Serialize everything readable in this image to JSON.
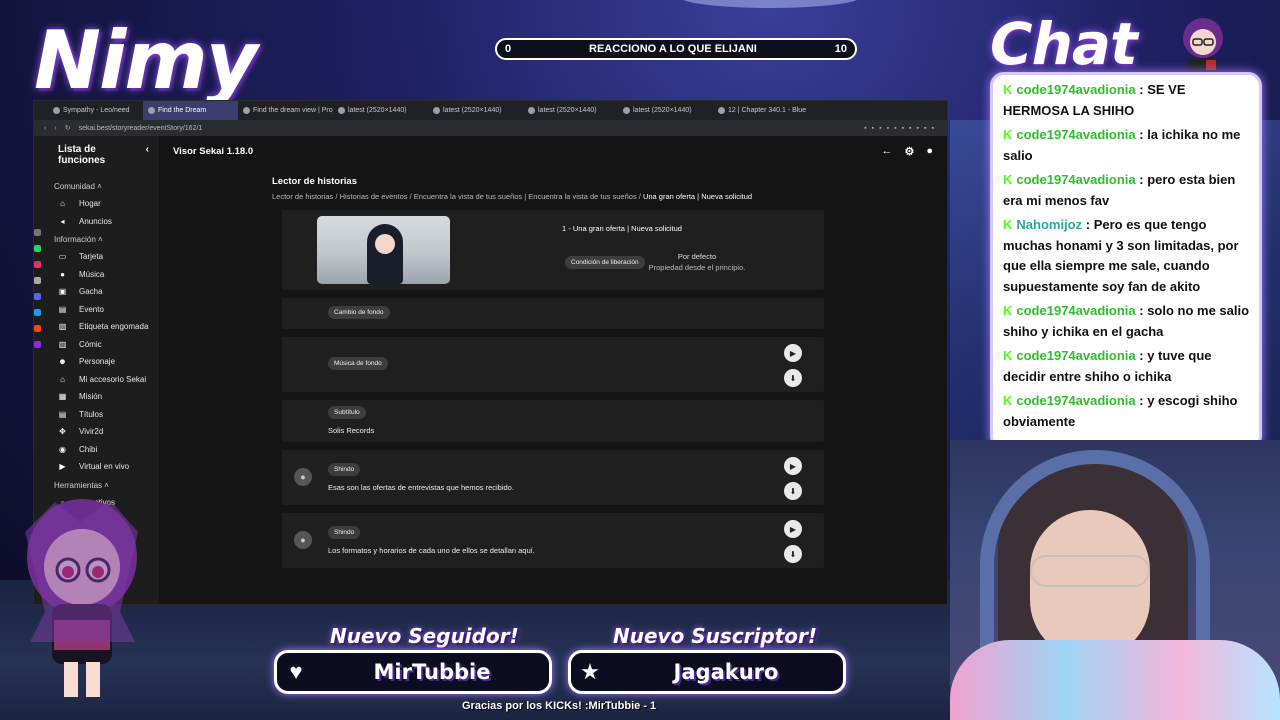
{
  "overlay": {
    "streamer_name": "Nimy",
    "chat_title": "Chat",
    "progress": {
      "left": "0",
      "label": "REACCIONO A LO QUE ELIJANI",
      "right": "10"
    },
    "follower_title": "Nuevo Seguidor!",
    "follower_name": "MirTubbie",
    "subscriber_title": "Nuevo Suscriptor!",
    "subscriber_name": "Jagakuro",
    "thanks": "Gracias por los KICKs! :MirTubbie - 1"
  },
  "browser": {
    "tabs": [
      "Sympathy - Leo/need",
      "Find the Dream",
      "Find the dream view | Proj",
      "latest (2520×1440)",
      "latest (2520×1440)",
      "latest (2520×1440)",
      "latest (2520×1440)",
      "12 | Chapter 340.1 - Blue L"
    ],
    "url": "sekai.best/storyreader/eventStory/162/1"
  },
  "sidebar": {
    "title": "Lista de funciones",
    "sections": [
      {
        "label": "Comunidad",
        "items": [
          {
            "label": "Hogar",
            "icon": "home-icon",
            "glyph": "⌂"
          },
          {
            "label": "Anuncios",
            "icon": "megaphone-icon",
            "glyph": "◂"
          }
        ]
      },
      {
        "label": "Información",
        "items": [
          {
            "label": "Tarjeta",
            "icon": "card-icon",
            "glyph": "▭"
          },
          {
            "label": "Música",
            "icon": "music-icon",
            "glyph": "●"
          },
          {
            "label": "Gacha",
            "icon": "gacha-icon",
            "glyph": "▣"
          },
          {
            "label": "Evento",
            "icon": "calendar-icon",
            "glyph": "▤"
          },
          {
            "label": "Etiqueta engomada",
            "icon": "sticker-icon",
            "glyph": "▧"
          },
          {
            "label": "Cómic",
            "icon": "comic-icon",
            "glyph": "▥"
          },
          {
            "label": "Personaje",
            "icon": "people-icon",
            "glyph": "☻"
          },
          {
            "label": "Mi accesorio Sekai",
            "icon": "home-icon",
            "glyph": "⌂"
          },
          {
            "label": "Misión",
            "icon": "mission-icon",
            "glyph": "▦"
          },
          {
            "label": "Títulos",
            "icon": "title-icon",
            "glyph": "▤"
          },
          {
            "label": "Vivir2d",
            "icon": "move-icon",
            "glyph": "✥"
          },
          {
            "label": "Chibi",
            "icon": "chibi-icon",
            "glyph": "◉"
          },
          {
            "label": "Virtual en vivo",
            "icon": "live-icon",
            "glyph": "▶"
          }
        ]
      },
      {
        "label": "Herramientas",
        "items": [
          {
            "label": "de activos",
            "icon": "asset-icon",
            "glyph": "▫"
          }
        ]
      }
    ]
  },
  "app": {
    "title": "Visor Sekai 1.18.0",
    "page_heading": "Lector de historias",
    "breadcrumbs": [
      "Lector de historias",
      "Historias de eventos",
      "Encuentra la vista de tus sueños | Encuentra la vista de tus sueños",
      "Una gran oferta | Nueva solicitud"
    ],
    "episode_title": "1 - Una gran oferta | Nueva solicitud",
    "release_chip": "Condición de liberación",
    "release_title": "Por defecto",
    "release_desc": "Propiedad desde el principio.",
    "blocks": [
      {
        "chip": "Cambio de fondo"
      },
      {
        "chip": "Música de fondo"
      },
      {
        "chip": "Subtítulo",
        "text": "Solis Records"
      },
      {
        "chip": "Shindo",
        "text": "Esas son las ofertas de entrevistas que hemos recibido."
      },
      {
        "chip": "Shindo",
        "text": "Los formatos y horarios de cada uno de ellos se detallan aquí."
      }
    ]
  },
  "chat": {
    "messages": [
      {
        "user": "code1974avadionia",
        "text": ": SE VE HERMOSA LA SHIHO"
      },
      {
        "user": "code1974avadionia",
        "text": ": la ichika no me salio"
      },
      {
        "user": "code1974avadionia",
        "text": ": pero esta bien era mi menos fav"
      },
      {
        "user": "Nahomijoz",
        "text": ": Pero es que tengo muchas honami y 3 son limitadas, por que ella siempre me sale, cuando supuestamente soy fan de akito"
      },
      {
        "user": "code1974avadionia",
        "text": ": solo no me salio shiho y ichika en el gacha"
      },
      {
        "user": "code1974avadionia",
        "text": ": y tuve que decidir entre shiho o ichika"
      },
      {
        "user": "code1974avadionia",
        "text": ": y escogi shiho obviamente"
      }
    ]
  },
  "colors": {
    "accent": "#9b59ff",
    "kick_green": "#53fc18",
    "panel": "#1f1f1f"
  }
}
